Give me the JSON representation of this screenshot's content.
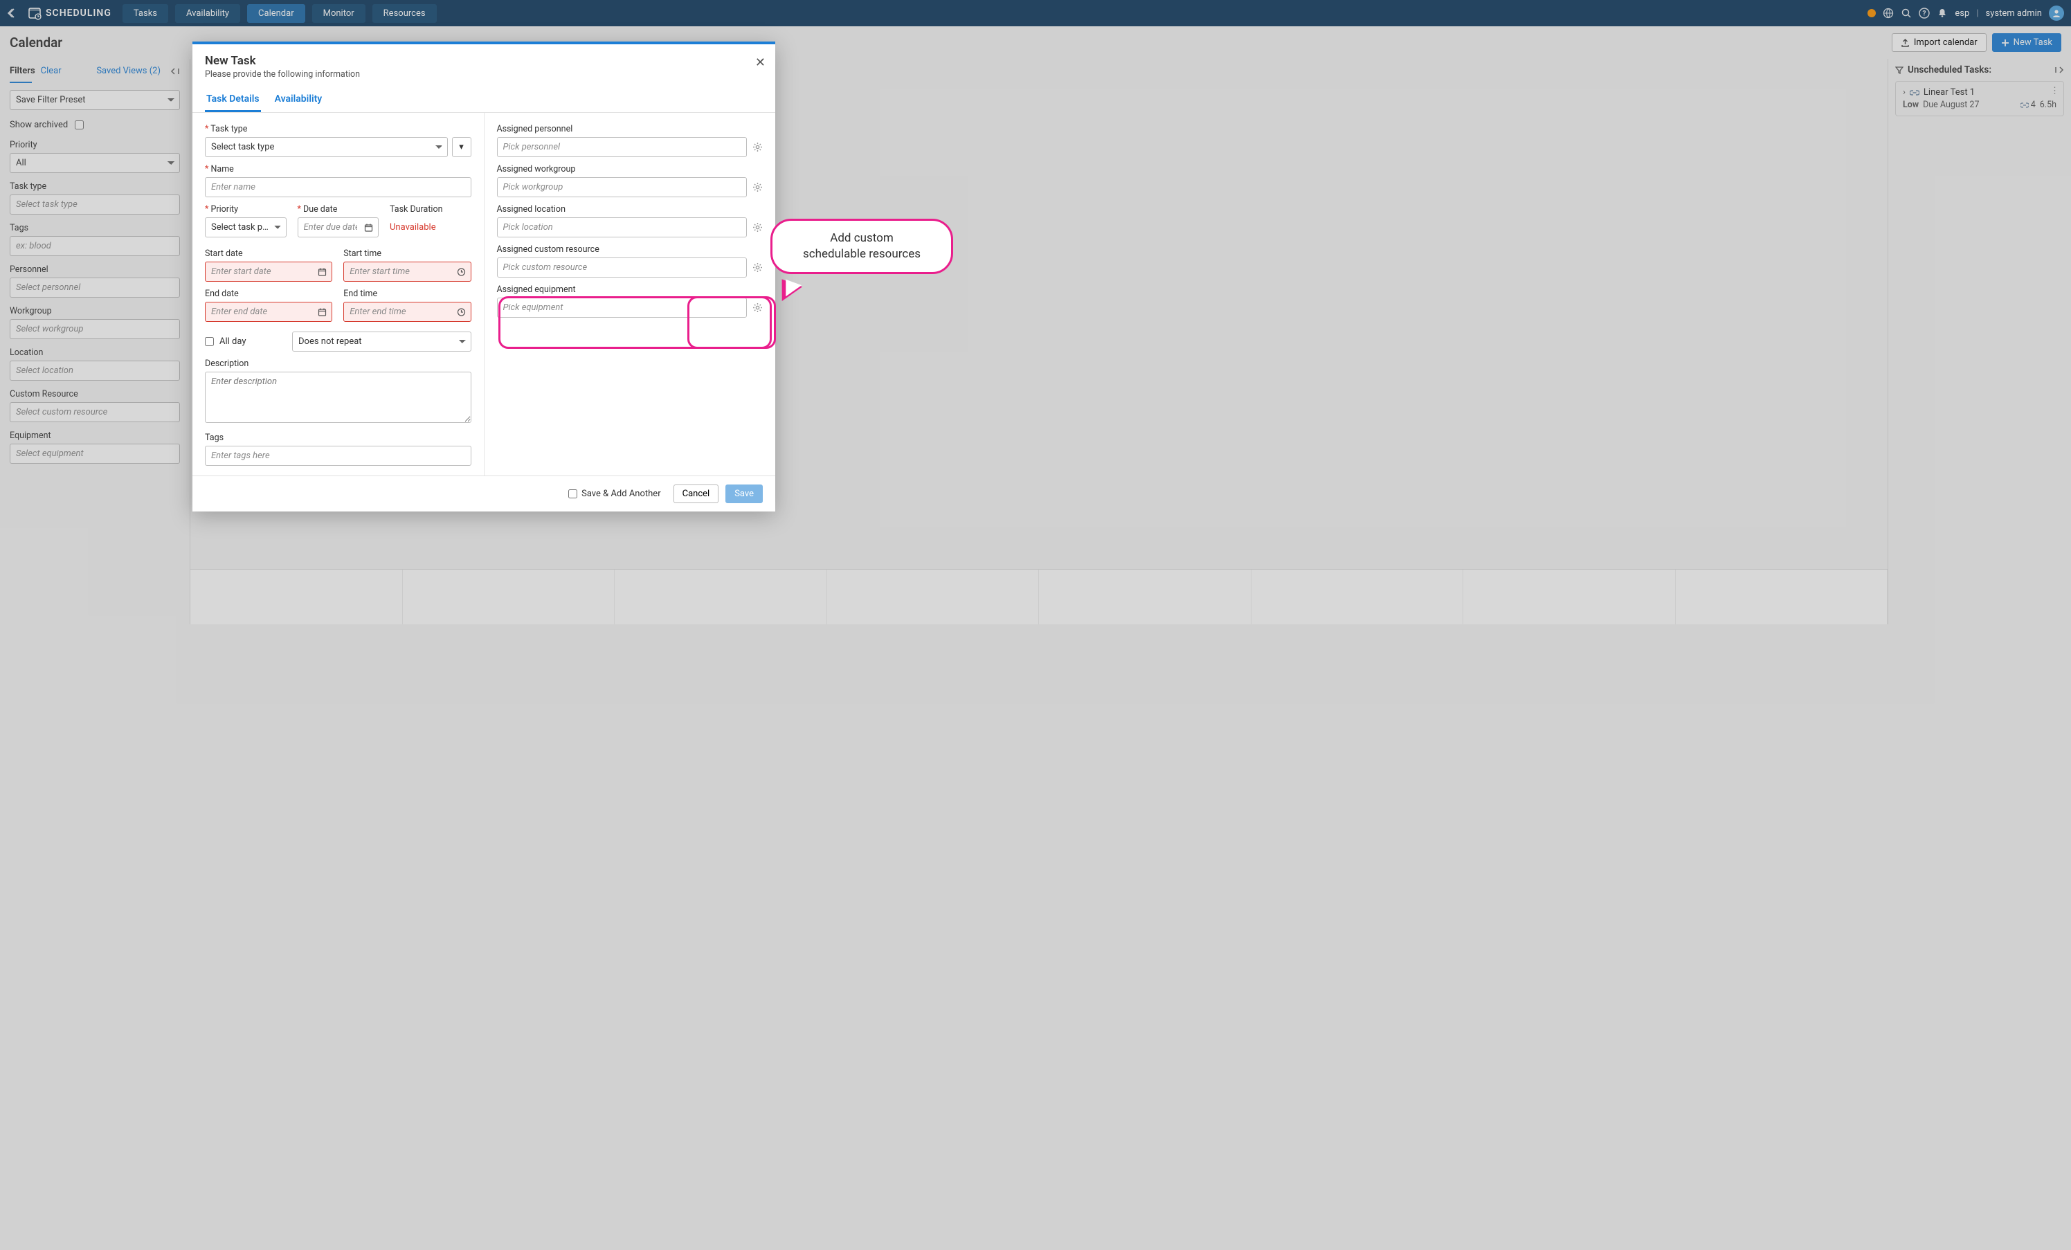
{
  "app": {
    "title": "SCHEDULING"
  },
  "nav": {
    "tabs": [
      {
        "label": "Tasks"
      },
      {
        "label": "Availability"
      },
      {
        "label": "Calendar"
      },
      {
        "label": "Monitor"
      },
      {
        "label": "Resources"
      }
    ]
  },
  "user": {
    "org": "esp",
    "name": "system admin"
  },
  "page": {
    "title": "Calendar",
    "import_btn": "Import calendar",
    "new_task_btn": "New Task"
  },
  "filters": {
    "heading": "Filters",
    "clear": "Clear",
    "saved_views": "Saved Views (2)",
    "preset_label": "Save Filter Preset",
    "show_archived": "Show archived",
    "priority_label": "Priority",
    "priority_value": "All",
    "tasktype_label": "Task type",
    "tasktype_ph": "Select task type",
    "tags_label": "Tags",
    "tags_ph": "ex: blood",
    "personnel_label": "Personnel",
    "personnel_ph": "Select personnel",
    "workgroup_label": "Workgroup",
    "workgroup_ph": "Select workgroup",
    "location_label": "Location",
    "location_ph": "Select location",
    "custom_label": "Custom Resource",
    "custom_ph": "Select custom resource",
    "equipment_label": "Equipment",
    "equipment_ph": "Select equipment"
  },
  "unscheduled": {
    "heading": "Unscheduled Tasks:",
    "task": {
      "name": "Linear Test 1",
      "priority": "Low",
      "due": "Due August 27",
      "count": "4",
      "hours": "6.5h"
    }
  },
  "modal": {
    "title": "New Task",
    "subtitle": "Please provide the following information",
    "tabs": {
      "details": "Task Details",
      "availability": "Availability"
    },
    "left": {
      "tasktype_label": "Task type",
      "tasktype_ph": "Select task type",
      "name_label": "Name",
      "name_ph": "Enter name",
      "priority_label": "Priority",
      "priority_ph": "Select task p…",
      "due_label": "Due date",
      "due_ph": "Enter due date",
      "duration_label": "Task Duration",
      "duration_val": "Unavailable",
      "start_date_label": "Start date",
      "start_date_ph": "Enter start date",
      "start_time_label": "Start time",
      "start_time_ph": "Enter start time",
      "end_date_label": "End date",
      "end_date_ph": "Enter end date",
      "end_time_label": "End time",
      "end_time_ph": "Enter end time",
      "allday_label": "All day",
      "repeat_value": "Does not repeat",
      "desc_label": "Description",
      "desc_ph": "Enter description",
      "tags_label": "Tags",
      "tags_ph": "Enter tags here"
    },
    "right": {
      "personnel_label": "Assigned personnel",
      "personnel_ph": "Pick personnel",
      "workgroup_label": "Assigned workgroup",
      "workgroup_ph": "Pick workgroup",
      "location_label": "Assigned location",
      "location_ph": "Pick location",
      "custom_label": "Assigned custom resource",
      "custom_ph": "Pick custom resource",
      "equipment_label": "Assigned equipment",
      "equipment_ph": "Pick equipment"
    },
    "footer": {
      "save_add": "Save & Add Another",
      "cancel": "Cancel",
      "save": "Save"
    }
  },
  "callout": {
    "line1": "Add custom",
    "line2": "schedulable resources"
  }
}
